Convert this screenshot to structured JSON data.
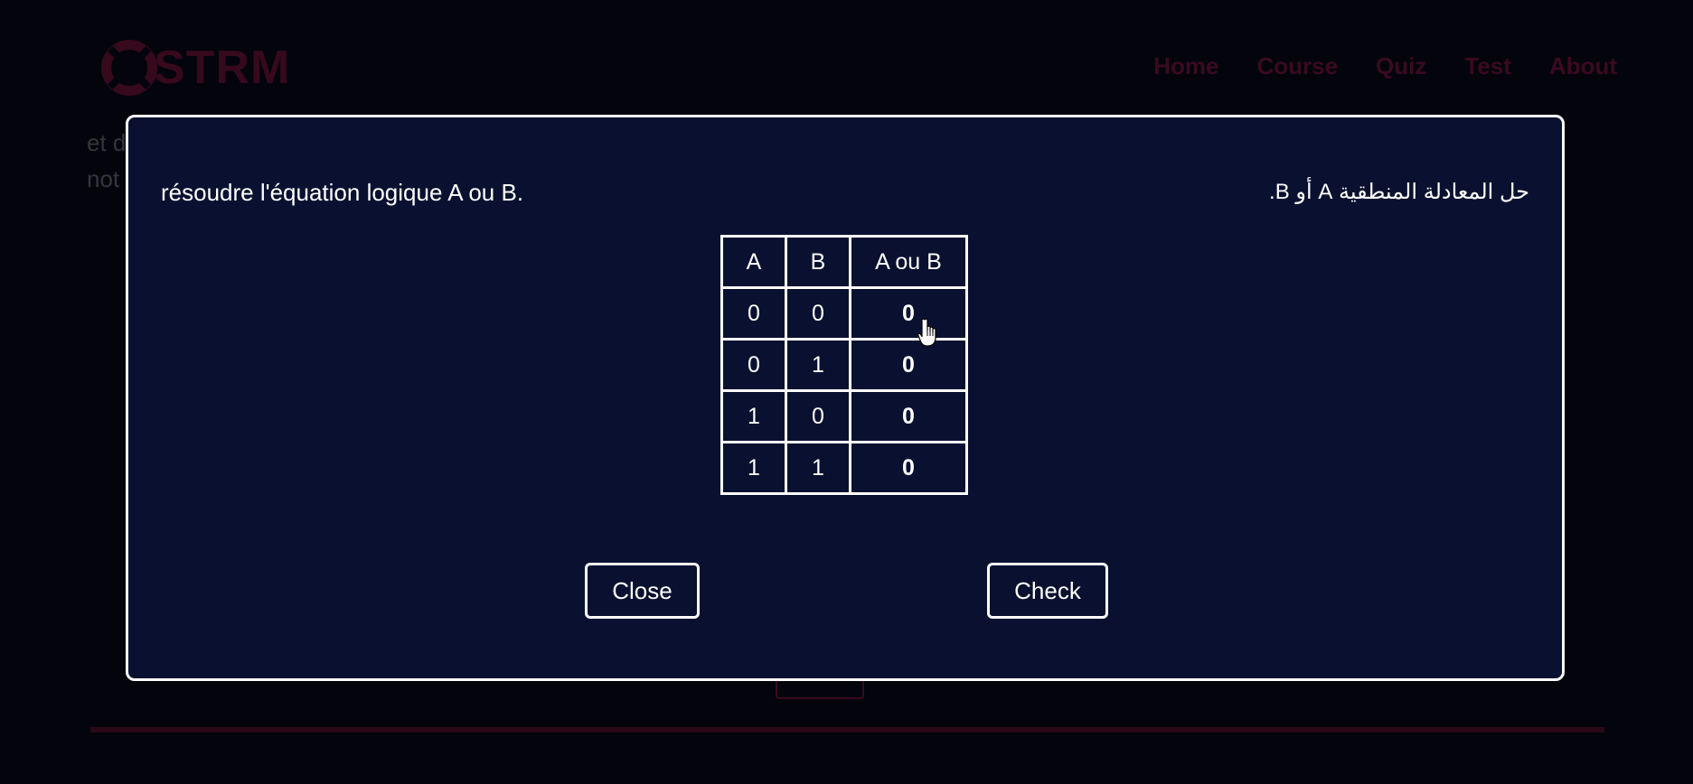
{
  "site": {
    "logo_text": "STRM",
    "nav": [
      "Home",
      "Course",
      "Quiz",
      "Test",
      "About"
    ],
    "bg_text_lines": [
      "et d",
      "not"
    ]
  },
  "modal": {
    "question_fr": "résoudre l'équation logique A ou B.",
    "question_ar": "حل المعادلة المنطقية A أو B.",
    "table": {
      "headers": [
        "A",
        "B",
        "A ou B"
      ],
      "rows": [
        [
          "0",
          "0",
          "0"
        ],
        [
          "0",
          "1",
          "0"
        ],
        [
          "1",
          "0",
          "0"
        ],
        [
          "1",
          "1",
          "0"
        ]
      ]
    },
    "close_label": "Close",
    "check_label": "Check"
  },
  "colors": {
    "page_bg": "#03040c",
    "modal_bg": "#0a1130",
    "accent_dim": "#3a0a20"
  }
}
